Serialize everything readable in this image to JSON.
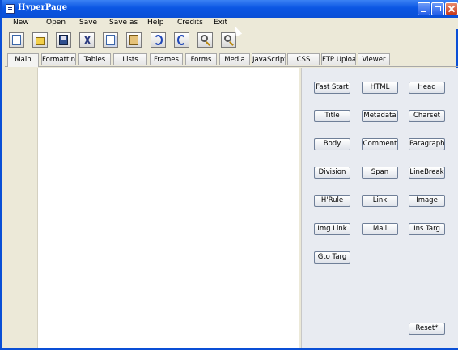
{
  "window": {
    "title": "HyperPage"
  },
  "menu": [
    "New",
    "Open",
    "Save",
    "Save as",
    "Help",
    "Credits",
    "Exit"
  ],
  "toolbar": [
    "new-document-icon",
    "open-folder-icon",
    "save-disk-icon",
    "cut-scissors-icon",
    "copy-icon",
    "paste-icon",
    "undo-icon",
    "redo-icon",
    "zoom-in-icon",
    "zoom-out-icon"
  ],
  "tabs": [
    "Main",
    "Formatting",
    "Tables",
    "Lists",
    "Frames",
    "Forms",
    "Media",
    "JavaScript",
    "CSS",
    "FTP Upload",
    "Viewer"
  ],
  "active_tab": "Main",
  "panel": {
    "buttons": [
      "Fast Start",
      "HTML",
      "Head",
      "Title",
      "Metadata",
      "Charset",
      "Body",
      "Comment",
      "Paragraph",
      "Division",
      "Span",
      "LineBreak",
      "H'Rule",
      "Link",
      "Image",
      "Img Link",
      "Mail",
      "Ins Targ",
      "Gto Targ"
    ],
    "reset": "Reset*"
  },
  "colors": {
    "titlebar": "#0a4fd6",
    "chrome": "#ece9d8",
    "editor": "#ffffff",
    "panel": "#e8ebf1"
  }
}
